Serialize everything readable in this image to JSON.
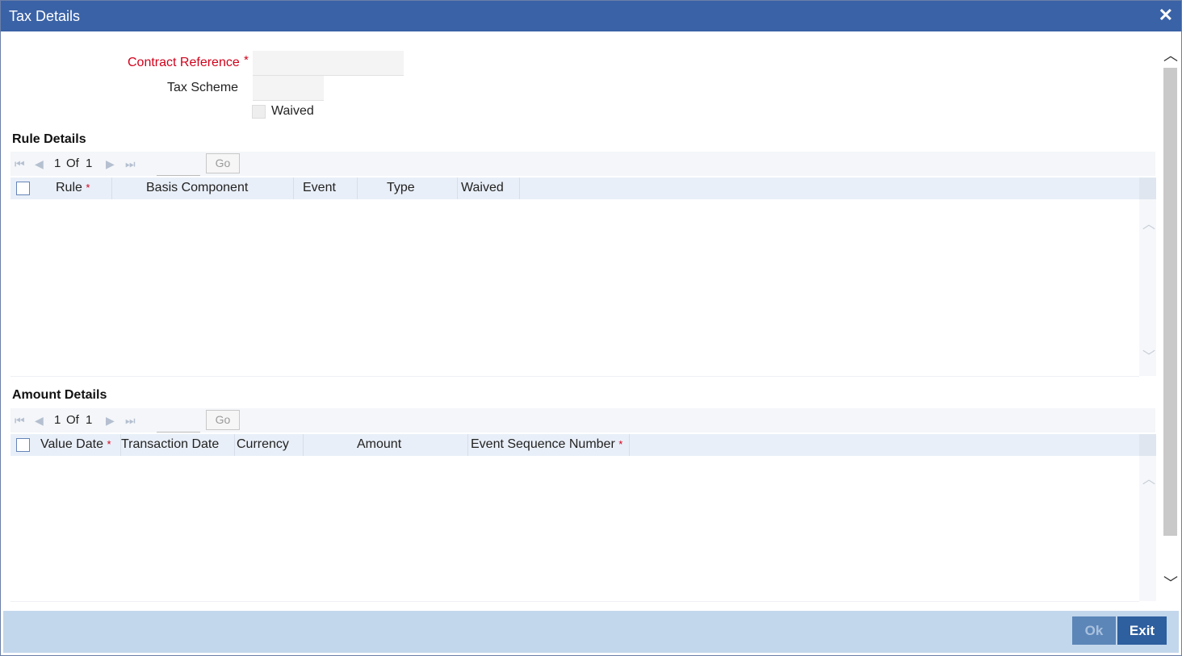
{
  "window": {
    "title": "Tax Details",
    "close_symbol": "✕"
  },
  "form": {
    "contract_reference_label": "Contract Reference",
    "contract_reference_value": "",
    "tax_scheme_label": "Tax Scheme",
    "tax_scheme_value": "",
    "waived_label": "Waived",
    "required_mark": "*"
  },
  "rule_details": {
    "title": "Rule Details",
    "pager": {
      "current": "1",
      "of": "Of",
      "total": "1",
      "go": "Go"
    },
    "columns": [
      "Rule",
      "Basis Component",
      "Event",
      "Type",
      "Waived"
    ],
    "required_mark": "*"
  },
  "amount_details": {
    "title": "Amount Details",
    "pager": {
      "current": "1",
      "of": "Of",
      "total": "1",
      "go": "Go"
    },
    "columns": [
      "Value Date",
      "Transaction Date",
      "Currency",
      "Amount",
      "Event Sequence Number"
    ],
    "required_mark": "*"
  },
  "footer": {
    "ok_label": "Ok",
    "exit_label": "Exit"
  },
  "icons": {
    "first": "first-page-icon",
    "prev": "prev-page-icon",
    "next": "next-page-icon",
    "last": "last-page-icon"
  },
  "colors": {
    "titlebar": "#3a62a6",
    "required": "#d0021b",
    "footer": "#c3d7ec",
    "exit_button": "#2e5f9e"
  }
}
